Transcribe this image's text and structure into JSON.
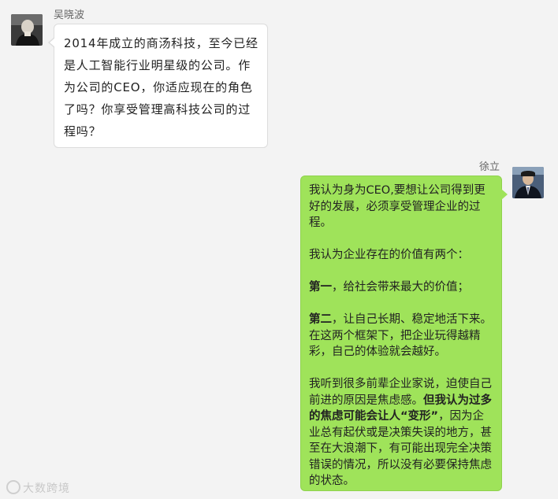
{
  "left_message": {
    "sender": "吴晓波",
    "text": "2014年成立的商汤科技，至今已经是人工智能行业明星级的公司。作为公司的CEO，你适应现在的角色了吗？你享受管理高科技公司的过程吗？"
  },
  "right_message": {
    "sender": "徐立",
    "p1": "我认为身为CEO,要想让公司得到更好的发展，必须享受管理企业的过程。",
    "p2": "我认为企业存在的价值有两个：",
    "p3_bold": "第一",
    "p3_rest": "，给社会带来最大的价值；",
    "p4_bold": "第二",
    "p4_rest": "，让自己长期、稳定地活下来。在这两个框架下，把企业玩得越精彩，自己的体验就会越好。",
    "p5_start": "我听到很多前辈企业家说，迫使自己前进的原因是焦虑感。",
    "p5_bold": "但我认为过多的焦虑可能会让人“变形”",
    "p5_end": "，因为企业总有起伏或是决策失误的地方，甚至在大浪潮下，有可能出现完全决策错误的情况，所以没有必要保持焦虑的状态。"
  },
  "watermark": "大数跨境",
  "colors": {
    "background": "#f3f3f3",
    "left_bubble": "#ffffff",
    "right_bubble": "#9fe35a"
  }
}
